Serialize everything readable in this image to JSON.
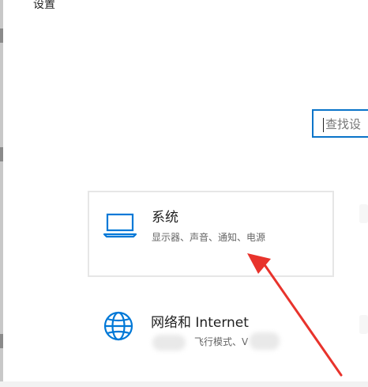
{
  "window": {
    "title": "设置"
  },
  "search": {
    "placeholder": "查找设",
    "value": ""
  },
  "items": [
    {
      "title": "系统",
      "description": "显示器、声音、通知、电源",
      "icon": "laptop-icon"
    },
    {
      "title": "网络和 Internet",
      "description": "飞行模式、V",
      "icon": "globe-icon"
    }
  ],
  "colors": {
    "accent": "#0a74c9",
    "icon": "#0078d7",
    "annotation_arrow": "#e8332c",
    "card_border": "#e6e6e6"
  }
}
